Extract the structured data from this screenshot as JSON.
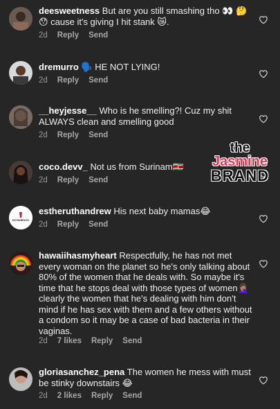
{
  "comments": [
    {
      "username": "deesweetness",
      "text": "But are you still smashing tho 👀 🤔😯 cause it's giving I hit stank 😿.",
      "time": "2d",
      "likes": "",
      "reply": "Reply",
      "send": "Send"
    },
    {
      "username": "dremurro",
      "text": "🗣️ HE NOT LYING!",
      "time": "2d",
      "likes": "",
      "reply": "Reply",
      "send": "Send"
    },
    {
      "username": "__heyjesse__",
      "text": "Who is he smelling?! Cuz my shit ALWAYS clean and smelling good",
      "time": "2d",
      "likes": "",
      "reply": "Reply",
      "send": "Send"
    },
    {
      "username": "coco.devv_",
      "text": "Not us from Surinam🇸🇷",
      "time": "2d",
      "likes": "",
      "reply": "Reply",
      "send": "Send"
    },
    {
      "username": "estheruthandrew",
      "text": "His next baby mamas😂",
      "time": "2d",
      "likes": "",
      "reply": "Reply",
      "send": "Send",
      "avatar_text": "ESTHERRUTH"
    },
    {
      "username": "hawaiihasmyheart",
      "text": "Respectfully, he has not met every woman on the planet so he's only talking about 80% of the women that he deals with. So maybe it's time that he stops deal with those types of women🤦🏽‍♀️ clearly the women that he's dealing with him don't mind if he has sex with them and a few others without a condom so it may be a case of bad bacteria in their vaginas.",
      "time": "2d",
      "likes": "7 likes",
      "reply": "Reply",
      "send": "Send"
    },
    {
      "username": "gloriasanchez_pena",
      "text": "The women he mess with must be stinky downstairs 😂",
      "time": "2d",
      "likes": "2 likes",
      "reply": "Reply",
      "send": "Send"
    }
  ],
  "watermark": {
    "line1": "the",
    "line2": "Jasmine",
    "line3": "BRAND"
  },
  "colors": {
    "background": "#262626",
    "text": "#efefef",
    "meta": "#9a9a9a",
    "brand_accent": "#e13a54"
  },
  "icons": {
    "like": "heart-outline-icon"
  }
}
